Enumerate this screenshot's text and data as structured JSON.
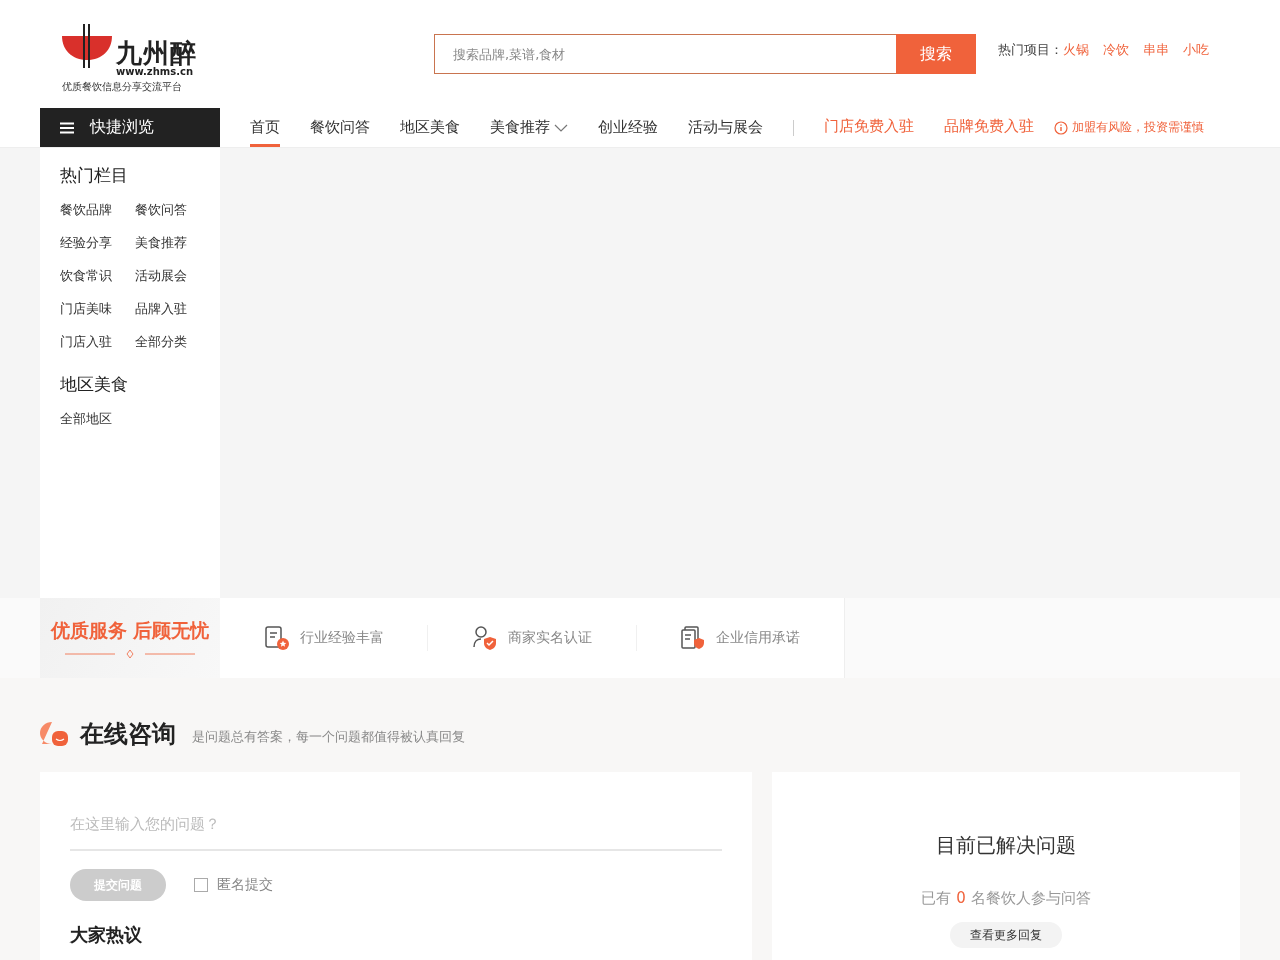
{
  "header": {
    "logo": {
      "name": "九州醉",
      "url": "www.zhms.cn",
      "slogan": "优质餐饮信息分享交流平台"
    },
    "search": {
      "placeholder": "搜索品牌,菜谱,食材",
      "button": "搜索"
    },
    "hot": {
      "label": "热门项目：",
      "items": [
        "火锅",
        "冷饮",
        "串串",
        "小吃"
      ]
    }
  },
  "nav": {
    "browse_button": "快捷浏览",
    "items": [
      {
        "label": "首页",
        "selected": true,
        "dropdown": false
      },
      {
        "label": "餐饮问答",
        "selected": false,
        "dropdown": false
      },
      {
        "label": "地区美食",
        "selected": false,
        "dropdown": false
      },
      {
        "label": "美食推荐",
        "selected": false,
        "dropdown": true
      },
      {
        "label": "创业经验",
        "selected": false,
        "dropdown": false
      },
      {
        "label": "活动与展会",
        "selected": false,
        "dropdown": false
      }
    ],
    "join_links": [
      "门店免费入驻",
      "品牌免费入驻"
    ],
    "risk_notice": "加盟有风险，投资需谨慎"
  },
  "sidebar": {
    "sections": [
      {
        "title": "热门栏目",
        "links": [
          "餐饮品牌",
          "餐饮问答",
          "经验分享",
          "美食推荐",
          "饮食常识",
          "活动展会",
          "门店美味",
          "品牌入驻",
          "门店入驻",
          "全部分类"
        ]
      },
      {
        "title": "地区美食",
        "links": [
          "全部地区"
        ]
      }
    ]
  },
  "features": {
    "slogan": "优质服务 后顾无忧",
    "items": [
      {
        "kind": "experience",
        "label": "行业经验丰富"
      },
      {
        "kind": "verified",
        "label": "商家实名认证"
      },
      {
        "kind": "credit",
        "label": "企业信用承诺"
      }
    ]
  },
  "consult": {
    "title": "在线咨询",
    "subtitle": "是问题总有答案，每一个问题都值得被认真回复",
    "form": {
      "placeholder": "在这里输入您的问题？",
      "submit": {
        "label": "提交问题",
        "disabled": true
      },
      "anonymous": {
        "label": "匿名提交",
        "checked": false
      }
    },
    "hot_title": "大家热议",
    "stats": {
      "title": "目前已解决问题",
      "prefix": "已有",
      "count": "0",
      "suffix": "名餐饮人参与问答",
      "button": "查看更多回复"
    }
  }
}
